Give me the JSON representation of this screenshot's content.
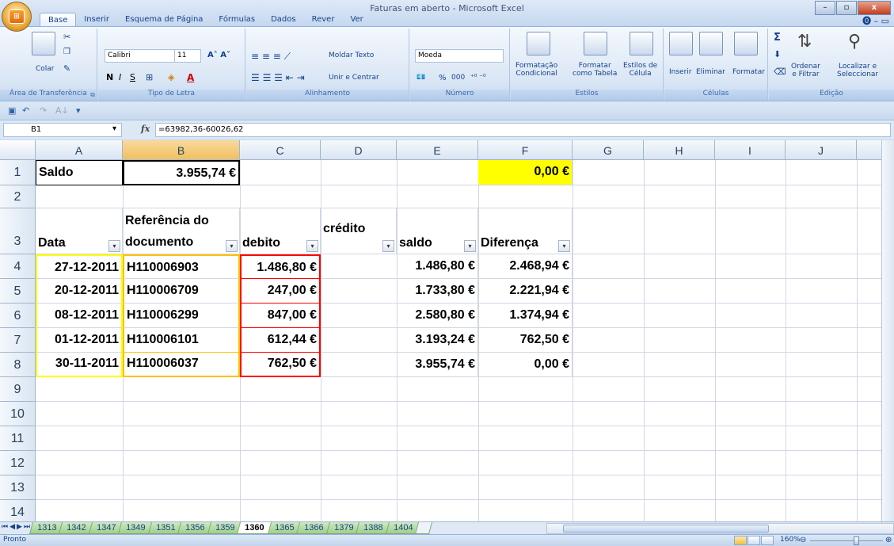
{
  "window": {
    "title": "Faturas em aberto - Microsoft Excel"
  },
  "tabs": [
    "Base",
    "Inserir",
    "Esquema de Página",
    "Fórmulas",
    "Dados",
    "Rever",
    "Ver"
  ],
  "active_tab": "Base",
  "ribbon": {
    "clipboard": {
      "label": "Área de Transferência",
      "paste": "Colar"
    },
    "font": {
      "label": "Tipo de Letra",
      "font_name": "Calibri",
      "font_size": "11",
      "bold": "N",
      "italic": "I",
      "underline": "S"
    },
    "alignment": {
      "label": "Alinhamento",
      "wrap": "Moldar Texto",
      "merge": "Unir e Centrar"
    },
    "number": {
      "label": "Número",
      "format": "Moeda",
      "percent": "%",
      "thousands": "000"
    },
    "styles": {
      "label": "Estilos",
      "conditional_1": "Formatação",
      "conditional_2": "Condicional",
      "table_1": "Formatar",
      "table_2": "como Tabela",
      "cell_1": "Estilos de",
      "cell_2": "Célula"
    },
    "cells": {
      "label": "Células",
      "insert": "Inserir",
      "delete": "Eliminar",
      "format": "Formatar"
    },
    "editing": {
      "label": "Edição",
      "sort_1": "Ordenar",
      "sort_2": "e Filtrar",
      "find_1": "Localizar e",
      "find_2": "Seleccionar"
    }
  },
  "formula_bar": {
    "name_box": "B1",
    "fx": "fx",
    "formula": "=63982,36-60026,62"
  },
  "columns": [
    "A",
    "B",
    "C",
    "D",
    "E",
    "F",
    "G",
    "H",
    "I",
    "J"
  ],
  "selected_column": "B",
  "rows": [
    "1",
    "2",
    "3",
    "4",
    "5",
    "6",
    "7",
    "8",
    "9",
    "10",
    "11",
    "12",
    "13",
    "14"
  ],
  "cells": {
    "r1": {
      "A": "Saldo",
      "B": "3.955,74 €",
      "F": "0,00 €"
    },
    "headers": {
      "A": "Data",
      "B_line1": "Referência do",
      "B_line2": "documento",
      "C": "debito",
      "D": "crédito",
      "E": "saldo",
      "F": "Diferença"
    },
    "data": [
      {
        "date": "27-12-2011",
        "ref": "H110006903",
        "debito": "1.486,80 €",
        "saldo": "1.486,80 €",
        "diff": "2.468,94 €"
      },
      {
        "date": "20-12-2011",
        "ref": "H110006709",
        "debito": "247,00 €",
        "saldo": "1.733,80 €",
        "diff": "2.221,94 €"
      },
      {
        "date": "08-12-2011",
        "ref": "H110006299",
        "debito": "847,00 €",
        "saldo": "2.580,80 €",
        "diff": "1.374,94 €"
      },
      {
        "date": "01-12-2011",
        "ref": "H110006101",
        "debito": "612,44 €",
        "saldo": "3.193,24 €",
        "diff": "762,50 €"
      },
      {
        "date": "30-11-2011",
        "ref": "H110006037",
        "debito": "762,50 €",
        "saldo": "3.955,74 €",
        "diff": "0,00 €"
      }
    ]
  },
  "colors": {
    "highlight_yellow": "#ffff00",
    "border_yellow": "#ffff00",
    "border_orange": "#ffc000",
    "border_red": "#ff0000"
  },
  "sheet_tabs": [
    "1313",
    "1342",
    "1347",
    "1349",
    "1351",
    "1356",
    "1359",
    "1360",
    "1365",
    "1366",
    "1379",
    "1388",
    "1404"
  ],
  "active_sheet": "1360",
  "status": {
    "text": "Pronto",
    "zoom": "160%"
  }
}
